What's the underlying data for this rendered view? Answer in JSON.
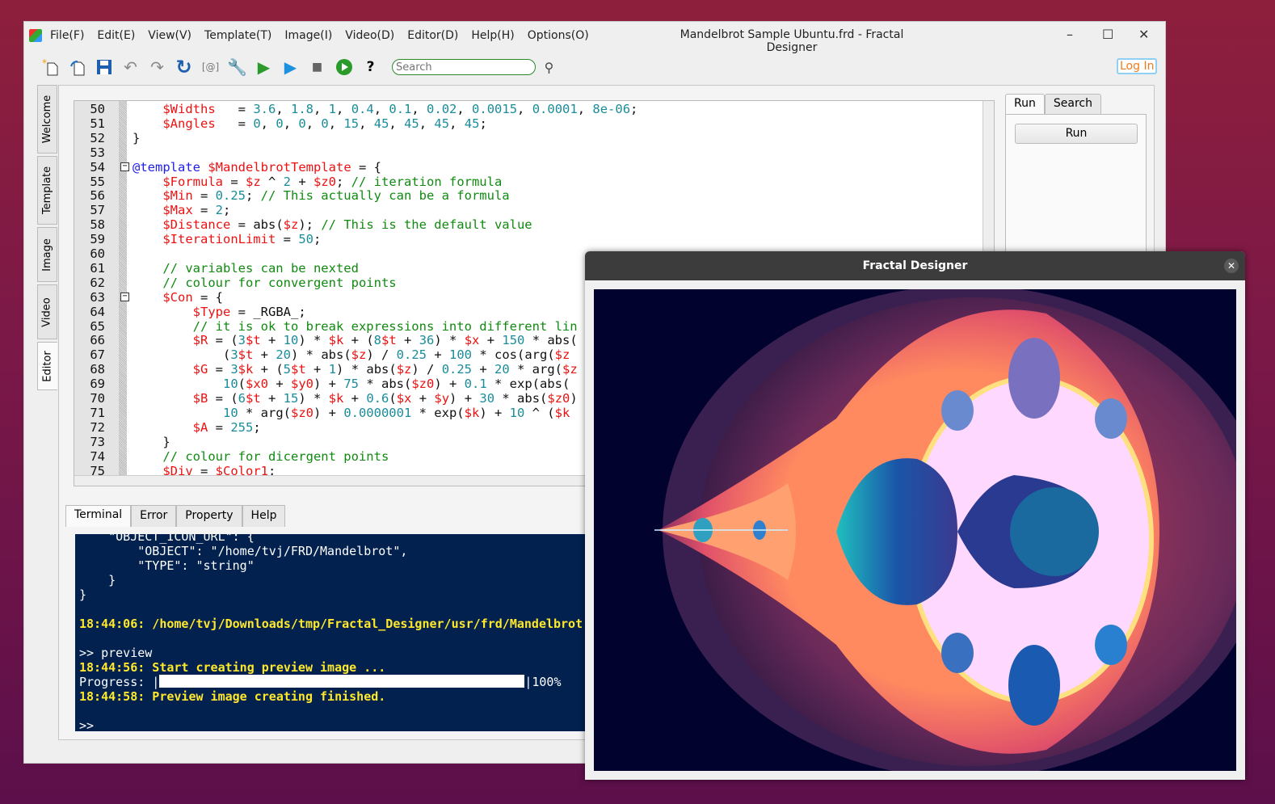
{
  "window": {
    "title": "Mandelbrot Sample Ubuntu.frd - Fractal Designer",
    "minimize": "–",
    "maximize": "☐",
    "close": "✕"
  },
  "menu": [
    "File(F)",
    "Edit(E)",
    "View(V)",
    "Template(T)",
    "Image(I)",
    "Video(D)",
    "Editor(D)",
    "Help(H)",
    "Options(O)"
  ],
  "toolbar": {
    "icons": [
      "new-file-icon",
      "open-file-icon",
      "save-icon",
      "undo-icon",
      "redo-icon",
      "refresh-icon",
      "clear-icon",
      "settings-wrench-icon",
      "run-icon",
      "run-preview-icon",
      "stop-icon",
      "play-circle-icon",
      "help-icon"
    ],
    "search_placeholder": "Search",
    "login_label": "Log In"
  },
  "colors": {
    "accent_green": "#2a8a2a",
    "login_orange": "#f07b1d",
    "terminal_bg": "#02214f",
    "terminal_highlight": "#ffe82c"
  },
  "side_tabs": [
    "Welcome",
    "Template",
    "Image",
    "Video",
    "Editor"
  ],
  "active_side_tab": "Editor",
  "editor": {
    "lines": [
      {
        "n": "50",
        "t": [
          [
            "p",
            "    "
          ],
          [
            "v",
            "$Widths"
          ],
          [
            "p",
            "   = "
          ],
          [
            "n",
            "3.6"
          ],
          [
            "p",
            ", "
          ],
          [
            "n",
            "1.8"
          ],
          [
            "p",
            ", "
          ],
          [
            "n",
            "1"
          ],
          [
            "p",
            ", "
          ],
          [
            "n",
            "0.4"
          ],
          [
            "p",
            ", "
          ],
          [
            "n",
            "0.1"
          ],
          [
            "p",
            ", "
          ],
          [
            "n",
            "0.02"
          ],
          [
            "p",
            ", "
          ],
          [
            "n",
            "0.0015"
          ],
          [
            "p",
            ", "
          ],
          [
            "n",
            "0.0001"
          ],
          [
            "p",
            ", "
          ],
          [
            "n",
            "8e-06"
          ],
          [
            "p",
            ";"
          ]
        ]
      },
      {
        "n": "51",
        "t": [
          [
            "p",
            "    "
          ],
          [
            "v",
            "$Angles"
          ],
          [
            "p",
            "   = "
          ],
          [
            "n",
            "0"
          ],
          [
            "p",
            ", "
          ],
          [
            "n",
            "0"
          ],
          [
            "p",
            ", "
          ],
          [
            "n",
            "0"
          ],
          [
            "p",
            ", "
          ],
          [
            "n",
            "0"
          ],
          [
            "p",
            ", "
          ],
          [
            "n",
            "15"
          ],
          [
            "p",
            ", "
          ],
          [
            "n",
            "45"
          ],
          [
            "p",
            ", "
          ],
          [
            "n",
            "45"
          ],
          [
            "p",
            ", "
          ],
          [
            "n",
            "45"
          ],
          [
            "p",
            ", "
          ],
          [
            "n",
            "45"
          ],
          [
            "p",
            ";"
          ]
        ]
      },
      {
        "n": "52",
        "t": [
          [
            "p",
            "}"
          ]
        ]
      },
      {
        "n": "53",
        "t": []
      },
      {
        "n": "54",
        "fold": true,
        "t": [
          [
            "k",
            "@template"
          ],
          [
            "p",
            " "
          ],
          [
            "v",
            "$MandelbrotTemplate"
          ],
          [
            "p",
            " = {"
          ]
        ]
      },
      {
        "n": "55",
        "t": [
          [
            "p",
            "    "
          ],
          [
            "v",
            "$Formula"
          ],
          [
            "p",
            " = "
          ],
          [
            "v",
            "$z"
          ],
          [
            "p",
            " ^ "
          ],
          [
            "n",
            "2"
          ],
          [
            "p",
            " + "
          ],
          [
            "v",
            "$z0"
          ],
          [
            "p",
            "; "
          ],
          [
            "c",
            "// iteration formula"
          ]
        ]
      },
      {
        "n": "56",
        "t": [
          [
            "p",
            "    "
          ],
          [
            "v",
            "$Min"
          ],
          [
            "p",
            " = "
          ],
          [
            "n",
            "0.25"
          ],
          [
            "p",
            "; "
          ],
          [
            "c",
            "// This actually can be a formula"
          ]
        ]
      },
      {
        "n": "57",
        "t": [
          [
            "p",
            "    "
          ],
          [
            "v",
            "$Max"
          ],
          [
            "p",
            " = "
          ],
          [
            "n",
            "2"
          ],
          [
            "p",
            ";"
          ]
        ]
      },
      {
        "n": "58",
        "t": [
          [
            "p",
            "    "
          ],
          [
            "v",
            "$Distance"
          ],
          [
            "p",
            " = abs("
          ],
          [
            "v",
            "$z"
          ],
          [
            "p",
            "); "
          ],
          [
            "c",
            "// This is the default value"
          ]
        ]
      },
      {
        "n": "59",
        "t": [
          [
            "p",
            "    "
          ],
          [
            "v",
            "$IterationLimit"
          ],
          [
            "p",
            " = "
          ],
          [
            "n",
            "50"
          ],
          [
            "p",
            ";"
          ]
        ]
      },
      {
        "n": "60",
        "t": []
      },
      {
        "n": "61",
        "t": [
          [
            "p",
            "    "
          ],
          [
            "c",
            "// variables can be nexted"
          ]
        ]
      },
      {
        "n": "62",
        "t": [
          [
            "p",
            "    "
          ],
          [
            "c",
            "// colour for convergent points"
          ]
        ]
      },
      {
        "n": "63",
        "fold": true,
        "t": [
          [
            "p",
            "    "
          ],
          [
            "v",
            "$Con"
          ],
          [
            "p",
            " = {"
          ]
        ]
      },
      {
        "n": "64",
        "t": [
          [
            "p",
            "        "
          ],
          [
            "v",
            "$Type"
          ],
          [
            "p",
            " = _RGBA_;"
          ]
        ]
      },
      {
        "n": "65",
        "t": [
          [
            "p",
            "        "
          ],
          [
            "c",
            "// it is ok to break expressions into different lin"
          ]
        ]
      },
      {
        "n": "66",
        "t": [
          [
            "p",
            "        "
          ],
          [
            "v",
            "$R"
          ],
          [
            "p",
            " = ("
          ],
          [
            "n",
            "3"
          ],
          [
            "v",
            "$t"
          ],
          [
            "p",
            " + "
          ],
          [
            "n",
            "10"
          ],
          [
            "p",
            ") * "
          ],
          [
            "v",
            "$k"
          ],
          [
            "p",
            " + ("
          ],
          [
            "n",
            "8"
          ],
          [
            "v",
            "$t"
          ],
          [
            "p",
            " + "
          ],
          [
            "n",
            "36"
          ],
          [
            "p",
            ") * "
          ],
          [
            "v",
            "$x"
          ],
          [
            "p",
            " + "
          ],
          [
            "n",
            "150"
          ],
          [
            "p",
            " * abs("
          ]
        ]
      },
      {
        "n": "67",
        "t": [
          [
            "p",
            "            ("
          ],
          [
            "n",
            "3"
          ],
          [
            "v",
            "$t"
          ],
          [
            "p",
            " + "
          ],
          [
            "n",
            "20"
          ],
          [
            "p",
            ") * abs("
          ],
          [
            "v",
            "$z"
          ],
          [
            "p",
            ") / "
          ],
          [
            "n",
            "0.25"
          ],
          [
            "p",
            " + "
          ],
          [
            "n",
            "100"
          ],
          [
            "p",
            " * cos(arg("
          ],
          [
            "v",
            "$z"
          ]
        ]
      },
      {
        "n": "68",
        "t": [
          [
            "p",
            "        "
          ],
          [
            "v",
            "$G"
          ],
          [
            "p",
            " = "
          ],
          [
            "n",
            "3"
          ],
          [
            "v",
            "$k"
          ],
          [
            "p",
            " + ("
          ],
          [
            "n",
            "5"
          ],
          [
            "v",
            "$t"
          ],
          [
            "p",
            " + "
          ],
          [
            "n",
            "1"
          ],
          [
            "p",
            ") * abs("
          ],
          [
            "v",
            "$z"
          ],
          [
            "p",
            ") / "
          ],
          [
            "n",
            "0.25"
          ],
          [
            "p",
            " + "
          ],
          [
            "n",
            "20"
          ],
          [
            "p",
            " * arg("
          ],
          [
            "v",
            "$z"
          ]
        ]
      },
      {
        "n": "69",
        "t": [
          [
            "p",
            "            "
          ],
          [
            "n",
            "10"
          ],
          [
            "p",
            "("
          ],
          [
            "v",
            "$x0"
          ],
          [
            "p",
            " + "
          ],
          [
            "v",
            "$y0"
          ],
          [
            "p",
            ") + "
          ],
          [
            "n",
            "75"
          ],
          [
            "p",
            " * abs("
          ],
          [
            "v",
            "$z0"
          ],
          [
            "p",
            ") + "
          ],
          [
            "n",
            "0.1"
          ],
          [
            "p",
            " * exp(abs("
          ]
        ]
      },
      {
        "n": "70",
        "t": [
          [
            "p",
            "        "
          ],
          [
            "v",
            "$B"
          ],
          [
            "p",
            " = ("
          ],
          [
            "n",
            "6"
          ],
          [
            "v",
            "$t"
          ],
          [
            "p",
            " + "
          ],
          [
            "n",
            "15"
          ],
          [
            "p",
            ") * "
          ],
          [
            "v",
            "$k"
          ],
          [
            "p",
            " + "
          ],
          [
            "n",
            "0.6"
          ],
          [
            "p",
            "("
          ],
          [
            "v",
            "$x"
          ],
          [
            "p",
            " + "
          ],
          [
            "v",
            "$y"
          ],
          [
            "p",
            ") + "
          ],
          [
            "n",
            "30"
          ],
          [
            "p",
            " * abs("
          ],
          [
            "v",
            "$z0"
          ],
          [
            "p",
            ")"
          ]
        ]
      },
      {
        "n": "71",
        "t": [
          [
            "p",
            "            "
          ],
          [
            "n",
            "10"
          ],
          [
            "p",
            " * arg("
          ],
          [
            "v",
            "$z0"
          ],
          [
            "p",
            ") + "
          ],
          [
            "n",
            "0.0000001"
          ],
          [
            "p",
            " * exp("
          ],
          [
            "v",
            "$k"
          ],
          [
            "p",
            ") + "
          ],
          [
            "n",
            "10"
          ],
          [
            "p",
            " ^ ("
          ],
          [
            "v",
            "$k"
          ]
        ]
      },
      {
        "n": "72",
        "t": [
          [
            "p",
            "        "
          ],
          [
            "v",
            "$A"
          ],
          [
            "p",
            " = "
          ],
          [
            "n",
            "255"
          ],
          [
            "p",
            ";"
          ]
        ]
      },
      {
        "n": "73",
        "t": [
          [
            "p",
            "    }"
          ]
        ]
      },
      {
        "n": "74",
        "t": [
          [
            "p",
            "    "
          ],
          [
            "c",
            "// colour for dicergent points"
          ]
        ]
      },
      {
        "n": "75",
        "t": [
          [
            "p",
            "    "
          ],
          [
            "v",
            "$Div"
          ],
          [
            "p",
            " = "
          ],
          [
            "v",
            "$Color1"
          ],
          [
            "p",
            ";"
          ]
        ]
      }
    ]
  },
  "right_panel": {
    "tabs": [
      "Run",
      "Search"
    ],
    "active": "Run",
    "run_button": "Run"
  },
  "bottom_tabs": [
    "Terminal",
    "Error",
    "Property",
    "Help"
  ],
  "active_bottom_tab": "Terminal",
  "terminal": {
    "lines": [
      {
        "text": "    \"OBJECT_ICON_URL\": {",
        "hl": false
      },
      {
        "text": "        \"OBJECT\": \"/home/tvj/FRD/Mandelbrot\",",
        "hl": false
      },
      {
        "text": "        \"TYPE\": \"string\"",
        "hl": false
      },
      {
        "text": "    }",
        "hl": false
      },
      {
        "text": "}",
        "hl": false
      },
      {
        "text": "",
        "hl": false
      },
      {
        "text": "18:44:06: /home/tvj/Downloads/tmp/Fractal_Designer/usr/frd/Mandelbrot",
        "hl": true
      },
      {
        "text": "",
        "hl": false
      },
      {
        "text": ">> preview",
        "hl": false
      },
      {
        "text": "18:44:56: Start creating preview image ...",
        "hl": true
      },
      {
        "progress": true,
        "label": "Progress: |",
        "suffix": "|100%",
        "value": 100
      },
      {
        "text": "18:44:58: Preview image creating finished.",
        "hl": true
      },
      {
        "text": "",
        "hl": false
      },
      {
        "text": ">>",
        "hl": false
      }
    ]
  },
  "preview_window": {
    "title": "Fractal Designer",
    "close": "✕"
  }
}
